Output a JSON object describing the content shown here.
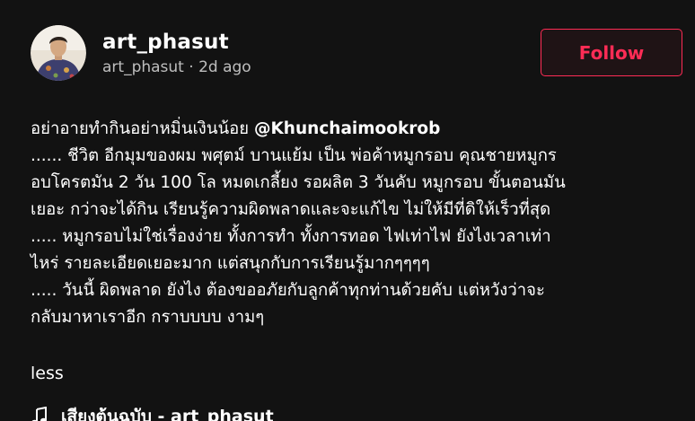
{
  "author": {
    "display_name": "art_phasut",
    "username": "art_phasut",
    "separator": "·",
    "posted": "2d ago",
    "avatar_icon": "user-avatar-photo"
  },
  "follow_button": {
    "label": "Follow",
    "color": "#fe2c55"
  },
  "caption": {
    "intro": "อย่าอายทำกินอย่าหมิ่นเงินน้อย ",
    "mention": "@Khunchaimookrob",
    "lines": [
      "...... ชีวิต อีกมุมของผม พศุตม์ บานแย้ม เป็น พ่อค้าหมูกรอบ คุณชายหมูกร",
      "อบโครตมัน 2 วัน 100 โล หมดเกลี้ยง รอผลิต 3 วันคับ หมูกรอบ ขั้นตอนมัน",
      "เยอะ กว่าจะได้กิน เรียนรู้ความผิดพลาดและจะแก้ไข ไม่ให้มีที่ดิให้เร็วที่สุด",
      "..... หมูกรอบไม่ใช่เรื่องง่าย ทั้งการทำ ทั้งการทอด ไฟเท่าไฟ ยังไงเวลาเท่า",
      "ไหร่ รายละเอียดเยอะมาก แต่สนุกกับการเรียนรู้มากๆๆๆๆ",
      "..... วันนี้ ผิดพลาด ยังไง ต้องขออภัยกับลูกค้าทุกท่านด้วยคับ แต่หวังว่าจะ",
      "กลับมาหาเราอีก กราบบบบ งามๆ"
    ]
  },
  "less_label": "less",
  "music": {
    "icon": "music-note-icon",
    "label": "เสียงต้นฉบับ - art_phasut"
  },
  "colors": {
    "background": "#121212",
    "text": "#ffffff",
    "accent": "#fe2c55"
  }
}
